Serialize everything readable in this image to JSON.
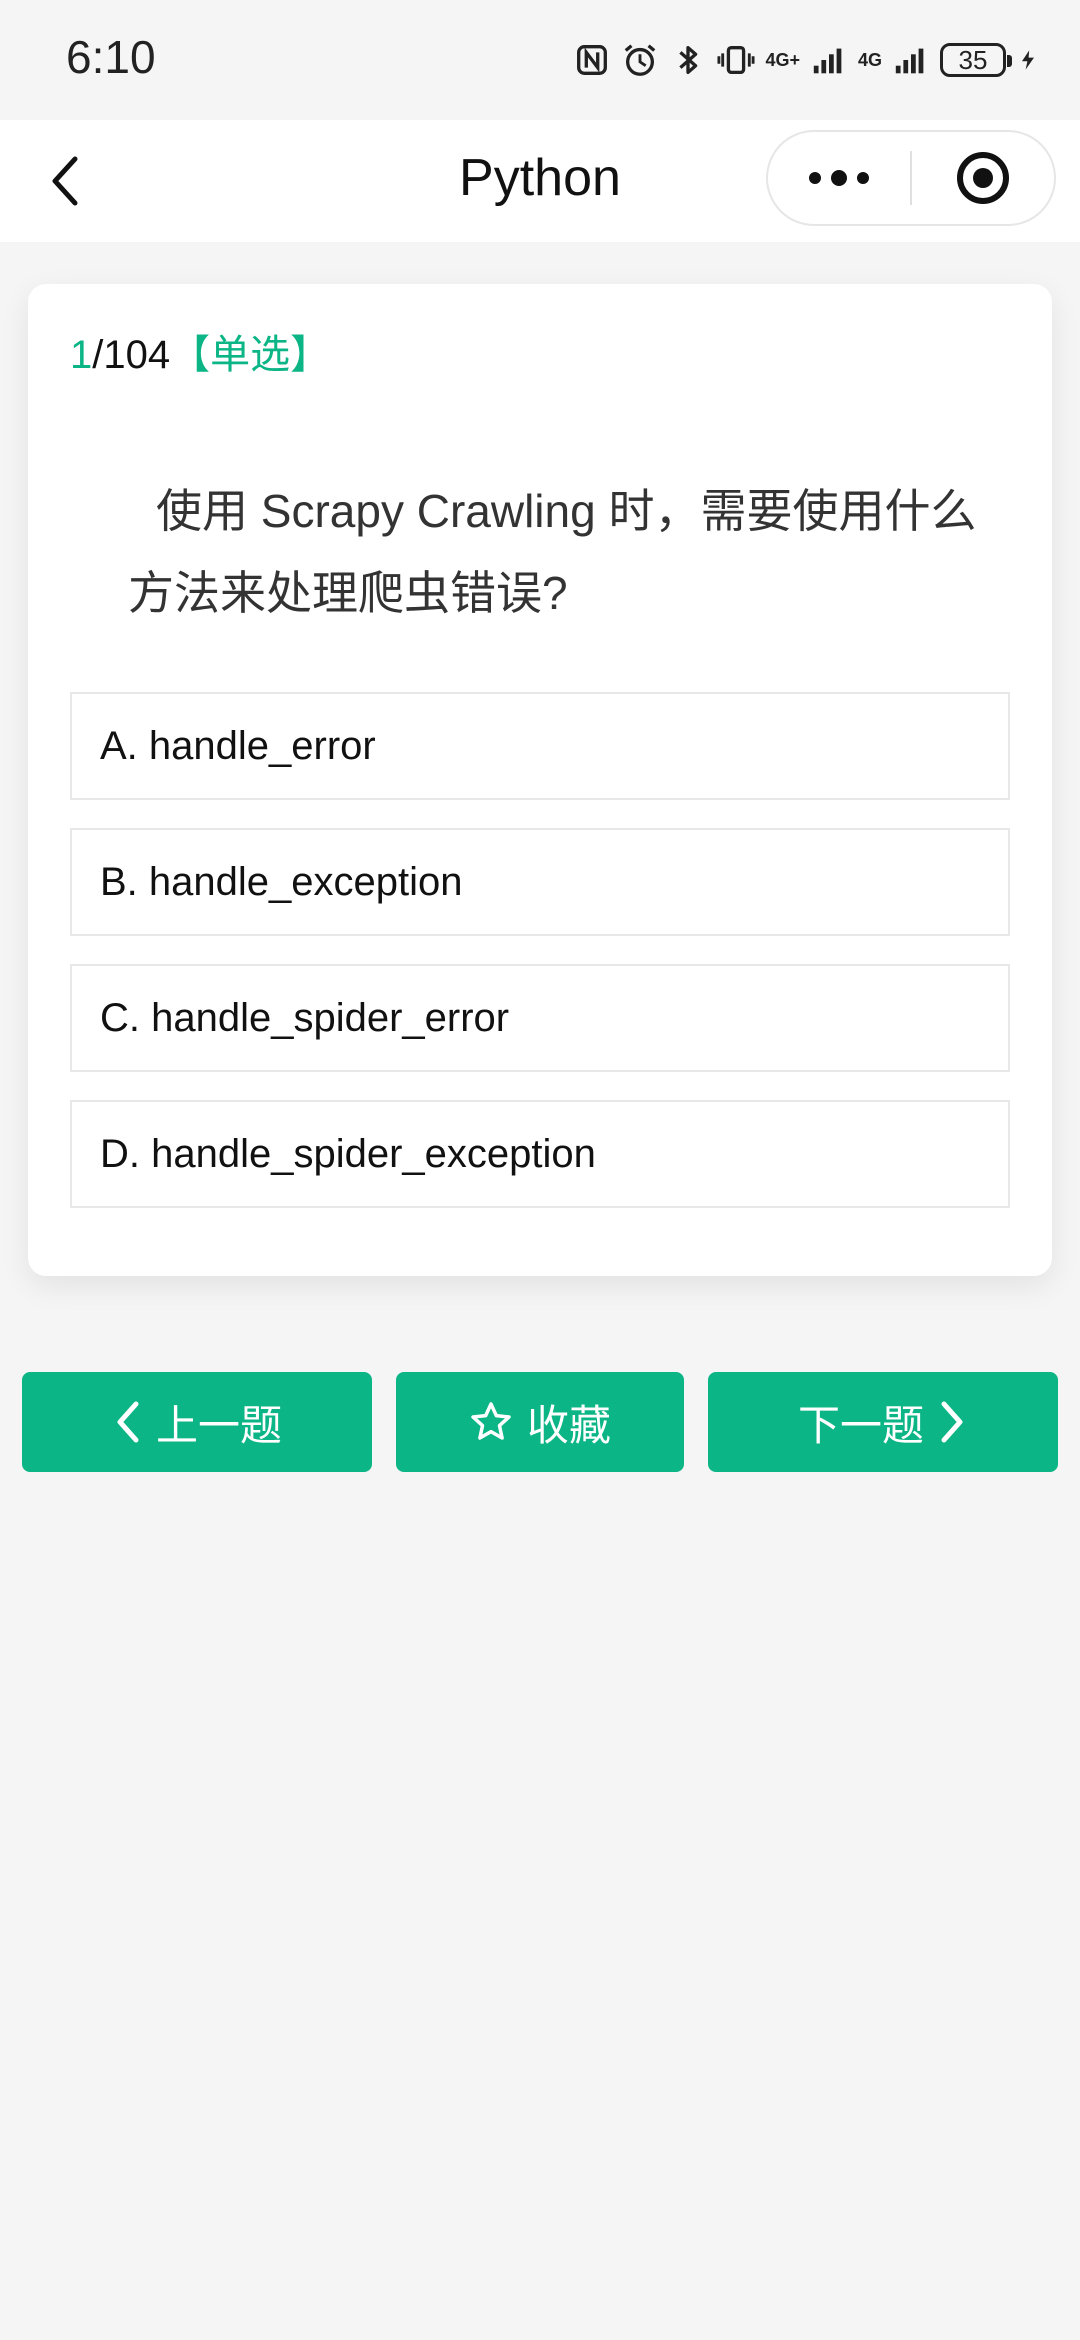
{
  "status_bar": {
    "time": "6:10",
    "network_1": "4G+",
    "network_2": "4G",
    "battery": "35",
    "icons": [
      "nfc-icon",
      "alarm-icon",
      "bluetooth-icon",
      "vibrate-icon",
      "signal-icon",
      "signal-icon",
      "battery-icon",
      "charging-icon"
    ]
  },
  "nav": {
    "title": "Python",
    "back_icon": "chevron-left-icon",
    "more_icon": "more-dots-icon",
    "close_icon": "target-circle-icon"
  },
  "question": {
    "current": "1",
    "total": "/104",
    "type": "【单选】",
    "text": "使用 Scrapy Crawling 时，需要使用什么方法来处理爬虫错误?",
    "options": [
      {
        "label": "A. handle_error"
      },
      {
        "label": "B. handle_exception"
      },
      {
        "label": "C. handle_spider_error"
      },
      {
        "label": "D. handle_spider_exception"
      }
    ]
  },
  "actions": {
    "prev_label": "上一题",
    "fav_label": "收藏",
    "next_label": "下一题"
  },
  "colors": {
    "accent": "#0bb585",
    "background": "#f5f5f5",
    "card": "#ffffff"
  }
}
